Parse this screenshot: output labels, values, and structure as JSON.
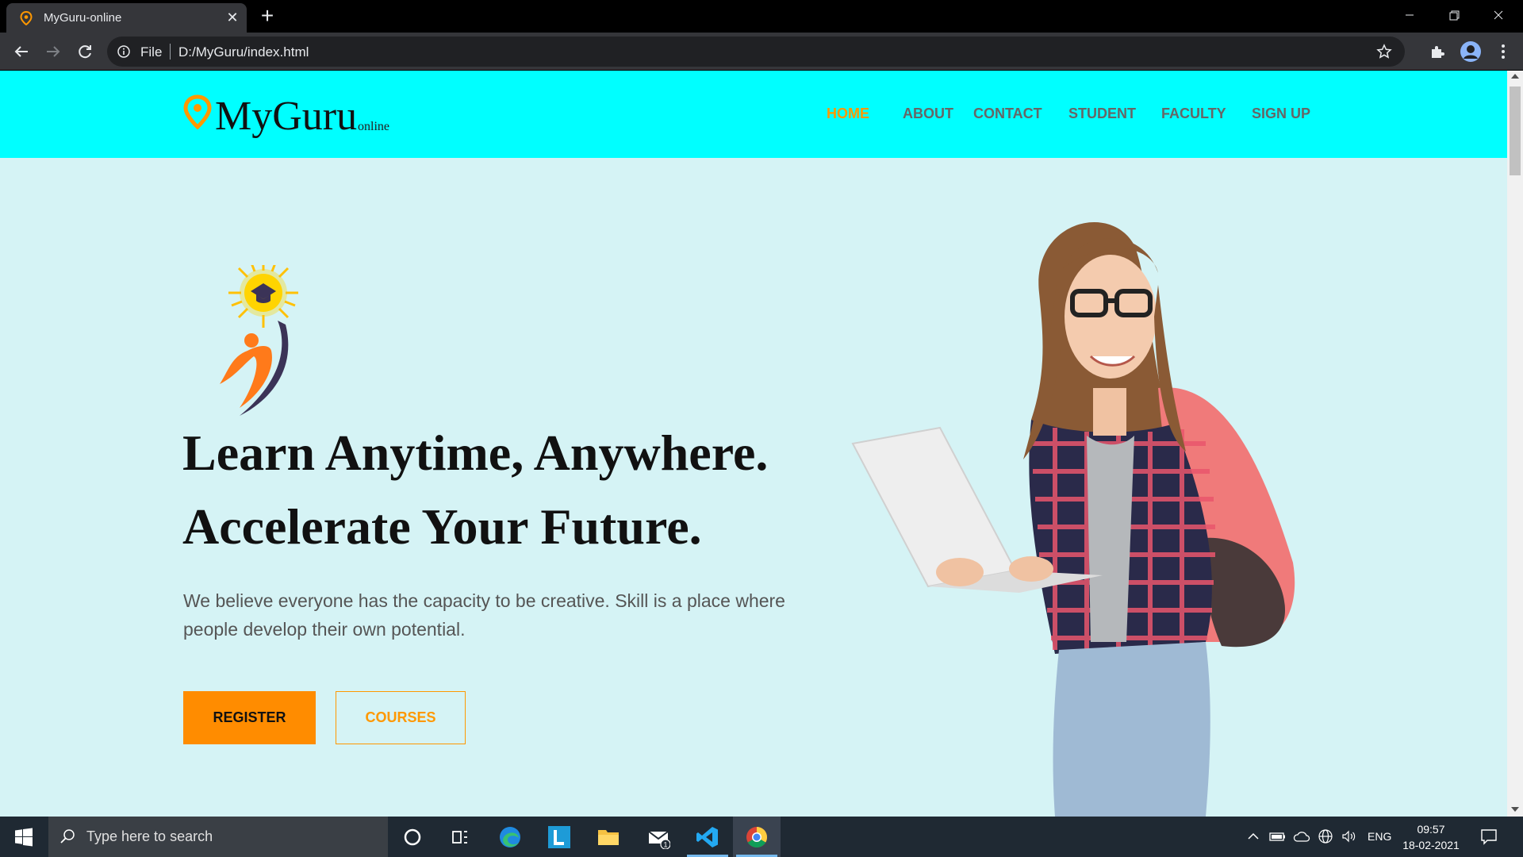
{
  "browser": {
    "tab_title": "MyGuru-online",
    "url_scheme": "File",
    "url": "D:/MyGuru/index.html"
  },
  "site": {
    "logo": {
      "name": "MyGuru",
      "suffix": "online"
    },
    "nav": [
      {
        "label": "HOME",
        "active": true
      },
      {
        "label": "ABOUT",
        "active": false
      },
      {
        "label": "CONTACT",
        "active": false
      },
      {
        "label": "STUDENT",
        "active": false
      },
      {
        "label": "FACULTY",
        "active": false
      },
      {
        "label": "SIGN UP",
        "active": false
      }
    ],
    "hero": {
      "headline_1": "Learn Anytime, Anywhere.",
      "headline_2": "Accelerate Your Future.",
      "lead": "We believe everyone has the capacity to be creative. Skill is a place where people develop their own potential.",
      "register_label": "REGISTER",
      "courses_label": "COURSES"
    }
  },
  "taskbar": {
    "search_placeholder": "Type here to search",
    "language": "ENG",
    "time": "09:57",
    "date": "18-02-2021",
    "mail_badge": "1"
  },
  "colors": {
    "header_bg": "#00ffff",
    "page_bg": "#d5f3f5",
    "accent": "#ff8c00"
  }
}
